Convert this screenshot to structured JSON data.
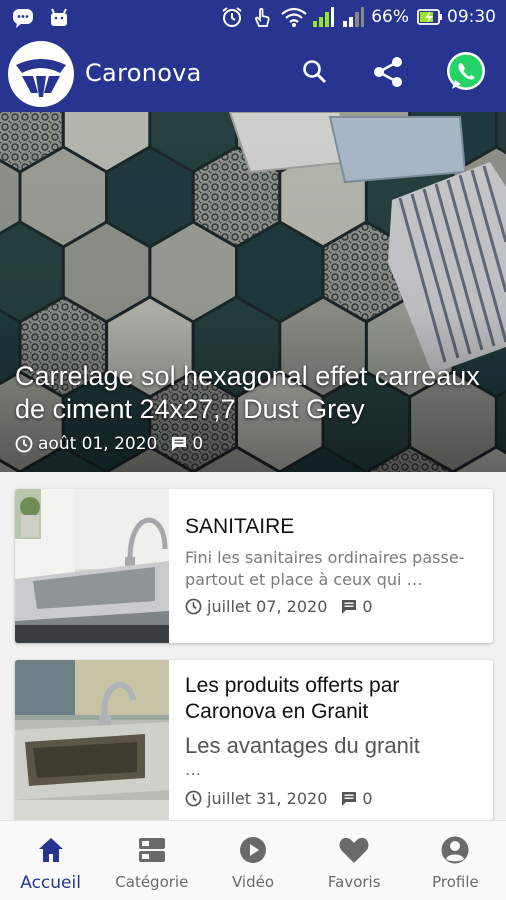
{
  "status_bar": {
    "battery": "66%",
    "time": "09:30",
    "icons": [
      "chat-notification-icon",
      "android-icon",
      "alarm-icon",
      "touch-icon",
      "wifi-icon",
      "signal-icon",
      "signal-2-icon",
      "battery-charging-icon"
    ]
  },
  "app_bar": {
    "title": "Caronova",
    "actions": [
      "search-icon",
      "share-icon",
      "whatsapp-icon"
    ]
  },
  "featured": {
    "title": "Carrelage sol hexagonal effet carreaux de ciment 24x27,7 Dust Grey",
    "date": "août 01, 2020",
    "comments": "0"
  },
  "posts": [
    {
      "title": "SANITAIRE",
      "excerpt": "Fini les sanitaires ordinaires passe-partout et place à ceux qui …",
      "date": "juillet 07, 2020",
      "comments": "0"
    },
    {
      "title": "Les produits offerts par Caronova en Granit",
      "excerpt": "Les avantages du granit",
      "ellipsis": "…",
      "date": "juillet 31, 2020",
      "comments": "0"
    }
  ],
  "bottom_nav": {
    "items": [
      {
        "label": "Accueil",
        "icon": "home-icon",
        "active": true
      },
      {
        "label": "Catégorie",
        "icon": "category-icon",
        "active": false
      },
      {
        "label": "Vidéo",
        "icon": "play-circle-icon",
        "active": false
      },
      {
        "label": "Favoris",
        "icon": "heart-icon",
        "active": false
      },
      {
        "label": "Profile",
        "icon": "account-circle-icon",
        "active": false
      }
    ]
  },
  "colors": {
    "primary": "#273591",
    "whatsapp": "#25d366",
    "battery_charge": "#9be22d"
  }
}
